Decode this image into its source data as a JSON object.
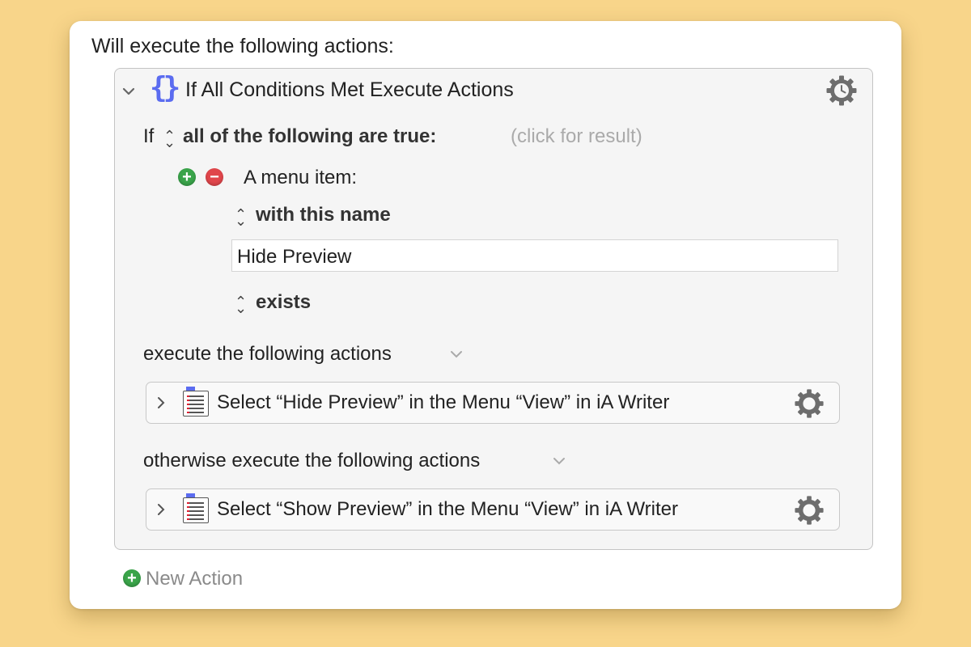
{
  "intro_text": "Will execute the following actions:",
  "group": {
    "title": "If All Conditions Met Execute Actions",
    "icon": "curly-braces-icon",
    "collapse_icon": "chevron-down-icon",
    "gear_icon": "gear-clock-icon"
  },
  "condition": {
    "if_label": "If",
    "match_mode": "all of the following are true:",
    "result_hint": "(click for result)",
    "item_label": "A menu item:",
    "name_mode": "with this name",
    "name_value": "Hide Preview",
    "state": "exists"
  },
  "then": {
    "label": "execute the following actions",
    "action": "Select “Hide Preview” in the Menu “View” in iA Writer"
  },
  "otherwise": {
    "label": "otherwise execute the following actions",
    "action": "Select “Show Preview” in the Menu “View” in iA Writer"
  },
  "new_action_label": "New Action",
  "colors": {
    "background": "#f8d58a",
    "brace_icon": "#5b6cf0",
    "add": "#3aa44a",
    "remove": "#e0464b"
  }
}
